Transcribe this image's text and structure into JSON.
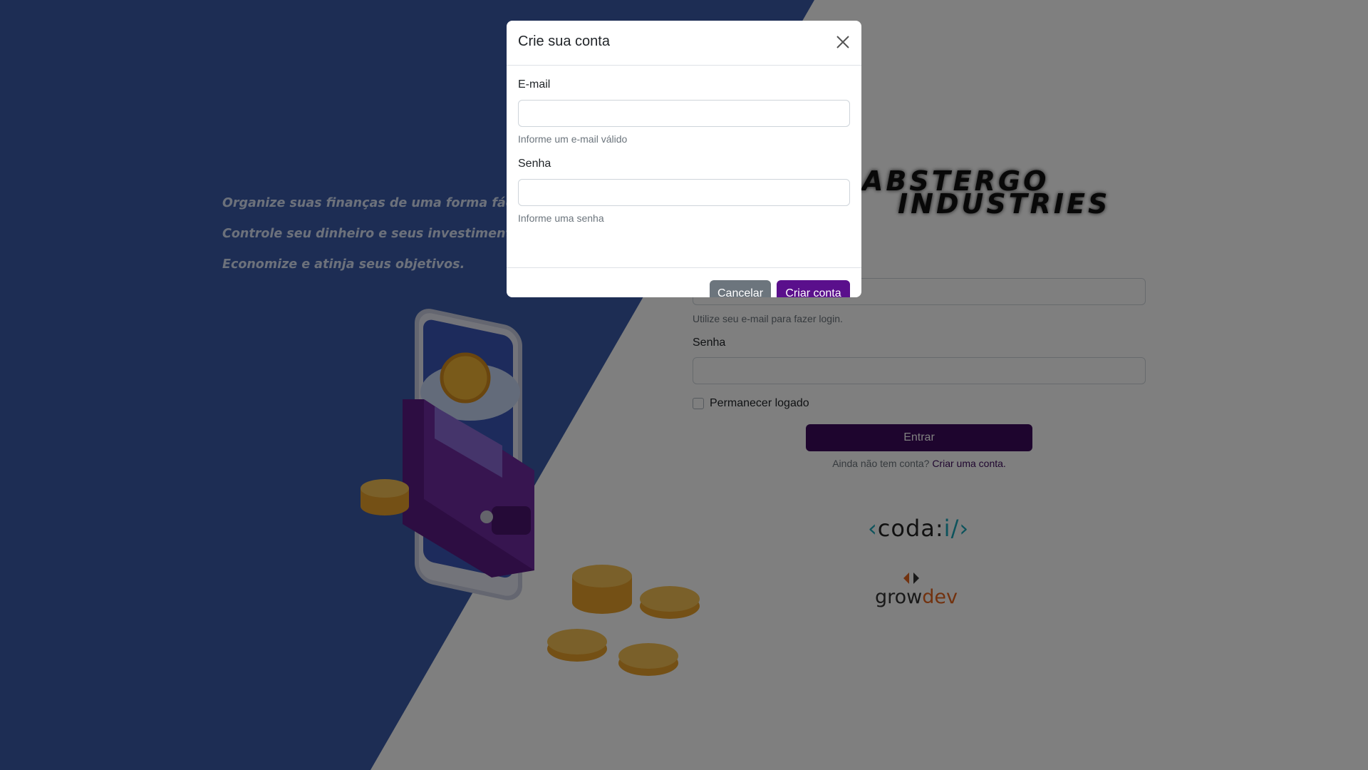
{
  "hero": {
    "taglines": [
      "Organize suas finanças de uma forma fácil.",
      "Controle seu dinheiro e seus investimentos.",
      "Economize e atinja seus objetivos."
    ],
    "illustration_icon": "wallet-phone-coins-illustration"
  },
  "logo": {
    "line1": "ABSTERGO",
    "line2": "INDUSTRIES"
  },
  "login": {
    "email_help": "Utilize seu e-mail para fazer login.",
    "password_label": "Senha",
    "remember_label": "Permanecer logado",
    "submit_label": "Entrar",
    "signup_prompt": "Ainda não tem conta?",
    "signup_link": "Criar uma conta."
  },
  "partners": {
    "coda_main": "coda:",
    "coda_accent": "i/",
    "coda_open": "‹",
    "coda_close": "›",
    "growdev_main": "grow",
    "growdev_accent": "dev"
  },
  "modal": {
    "title": "Crie sua conta",
    "email_label": "E-mail",
    "email_value": "",
    "email_help": "Informe um e-mail válido",
    "password_label": "Senha",
    "password_value": "",
    "password_help": "Informe uma senha",
    "cancel_label": "Cancelar",
    "create_label": "Criar conta"
  },
  "colors": {
    "primary_purple": "#5a0f8c",
    "dark_purple": "#3d0a5c",
    "hero_blue": "#3a5ba8",
    "secondary_gray": "#6c757d"
  }
}
